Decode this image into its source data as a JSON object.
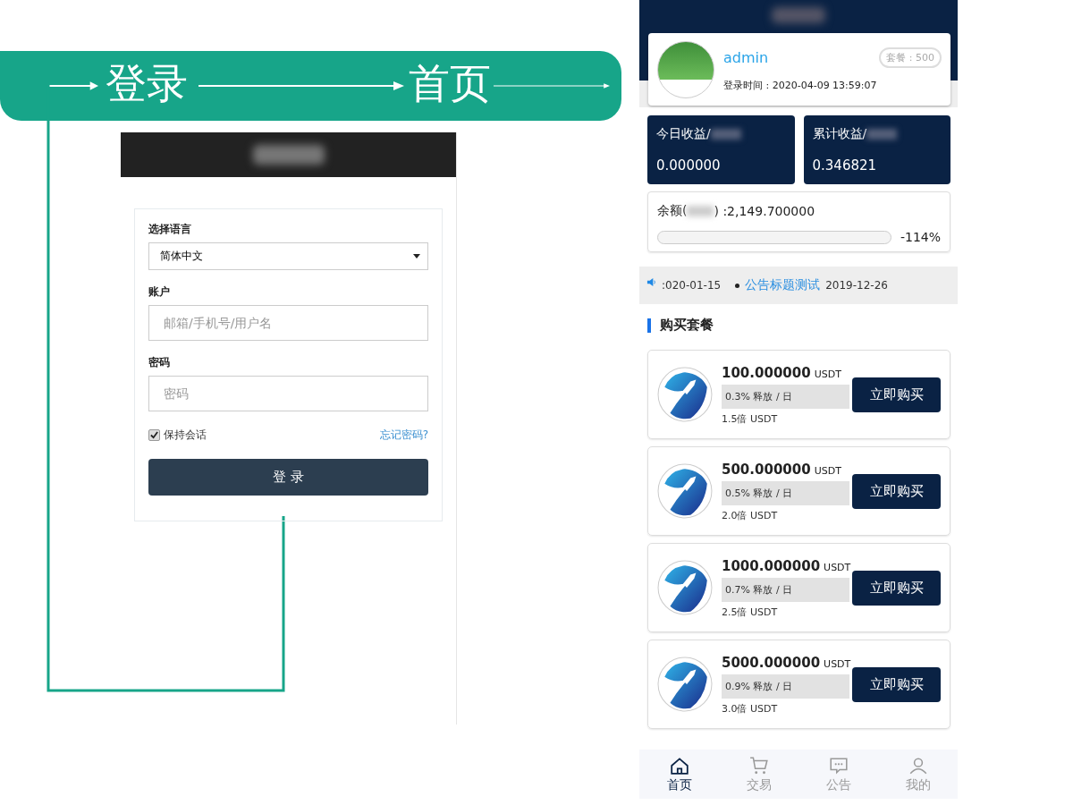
{
  "flow": {
    "steps": [
      {
        "label": "登录"
      },
      {
        "label": "首页"
      }
    ]
  },
  "login": {
    "language_label": "选择语言",
    "language_value": "简体中文",
    "account_label": "账户",
    "account_placeholder": "邮箱/手机号/用户名",
    "password_label": "密码",
    "password_placeholder": "密码",
    "remember": {
      "label": "保持会话",
      "checked": true
    },
    "forgot_link": "忘记密码?",
    "submit": "登 录"
  },
  "home": {
    "user": {
      "name": "admin",
      "badge": "套餐 : 500",
      "login_time": "登录时间 : 2020-04-09 13:59:07"
    },
    "stats": [
      {
        "label": "今日收益/",
        "value": "0.000000"
      },
      {
        "label": "累计收益/",
        "value": "0.346821"
      }
    ],
    "balance": {
      "prefix": "余额(",
      "suffix": ") :2,149.700000",
      "level": 0,
      "reading": "-114%"
    },
    "ticker": {
      "lead_date": ":020-01-15",
      "items": [
        {
          "title": "公告标题测试",
          "date": "2019-12-26"
        }
      ]
    },
    "section_title": "购买套餐",
    "packages": [
      {
        "amount": "100.000000",
        "unit": "USDT",
        "rate": "0.3% 释放 / 日",
        "multiple": "1.5倍 USDT",
        "button": "立即购买"
      },
      {
        "amount": "500.000000",
        "unit": "USDT",
        "rate": "0.5% 释放 / 日",
        "multiple": "2.0倍 USDT",
        "button": "立即购买"
      },
      {
        "amount": "1000.000000",
        "unit": "USDT",
        "rate": "0.7% 释放 / 日",
        "multiple": "2.5倍 USDT",
        "button": "立即购买"
      },
      {
        "amount": "5000.000000",
        "unit": "USDT",
        "rate": "0.9% 释放 / 日",
        "multiple": "3.0倍 USDT",
        "button": "立即购买"
      }
    ],
    "nav": [
      {
        "label": "首页",
        "kind": "home",
        "selected": true
      },
      {
        "label": "交易",
        "kind": "cart",
        "selected": false
      },
      {
        "label": "公告",
        "kind": "chat",
        "selected": false
      },
      {
        "label": "我的",
        "kind": "user",
        "selected": false
      }
    ]
  }
}
